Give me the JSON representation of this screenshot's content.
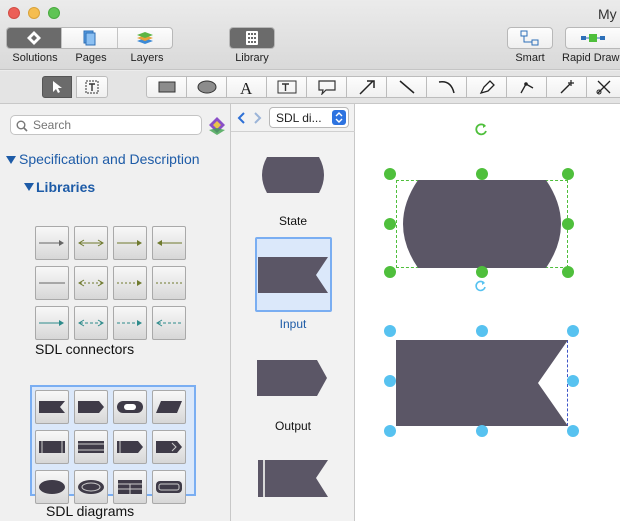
{
  "window": {
    "title": "My"
  },
  "toolbar": {
    "solutions": "Solutions",
    "pages": "Pages",
    "layers": "Layers",
    "library": "Library",
    "smart": "Smart",
    "rapid_draw": "Rapid Draw"
  },
  "search": {
    "placeholder": "Search"
  },
  "tree": {
    "section": "Specification and Description",
    "subsection": "Libraries"
  },
  "libraries": [
    {
      "name": "SDL connectors"
    },
    {
      "name": "SDL diagrams"
    }
  ],
  "library_panel": {
    "selected": "SDL di...",
    "shapes": [
      "State",
      "Input",
      "Output"
    ]
  },
  "colors": {
    "shape_fill": "#5b5666",
    "selected_handle": "#4fbf3c",
    "second_handle": "#57c2f0",
    "tree_text": "#1d5ba7"
  }
}
